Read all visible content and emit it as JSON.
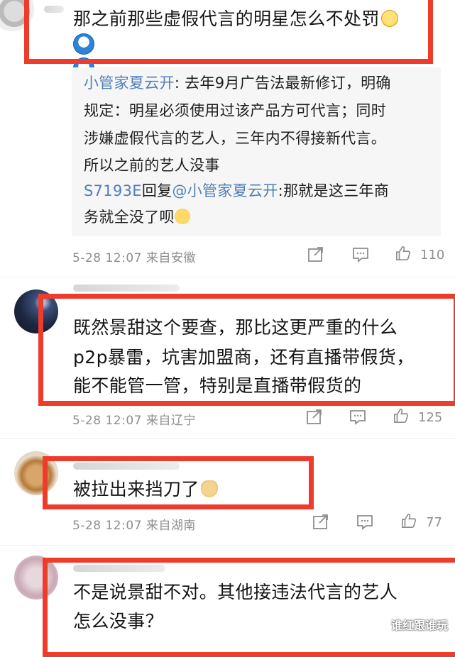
{
  "comments": [
    {
      "text_lines": [
        "那之前那些虚假代言的明星怎么不处罚"
      ],
      "meta": "5-28 12:07 来自安徽",
      "likes": "110",
      "replies": [
        {
          "author": "小管家夏云开",
          "lines": [
            ": 去年9月广告法最新修订，明确",
            "规定：明星必须使用过该产品方可代言；同时",
            "涉嫌虚假代言的艺人，三年内不得接新代言。",
            "所以之前的艺人没事"
          ]
        },
        {
          "author": "S7193E",
          "verb": "回复",
          "target": "@小管家夏云开",
          "lines": [
            ":那就是这三年商",
            "务就全没了呗"
          ]
        }
      ]
    },
    {
      "text_lines": [
        "既然景甜这个要查，那比这更严重的什么",
        "p2p暴雷，坑害加盟商，还有直播带假货，",
        "能不能管一管，特别是直播带假货的"
      ],
      "meta": "5-28 12:07 来自辽宁",
      "likes": "125"
    },
    {
      "text_lines": [
        "被拉出来挡刀了"
      ],
      "meta": "5-28 12:07 来自湖南",
      "likes": "77"
    },
    {
      "text_lines": [
        "不是说景甜不对。其他接违法代言的艺人",
        "怎么没事？"
      ]
    }
  ],
  "icons": {
    "share": "share-icon",
    "comment": "comment-icon",
    "like": "thumbs-up-icon"
  },
  "colors": {
    "highlight_box": "#ee3b2b",
    "link": "#4f7fb8",
    "meta": "#8e8e8e"
  },
  "watermark": "谁红跟谁玩"
}
